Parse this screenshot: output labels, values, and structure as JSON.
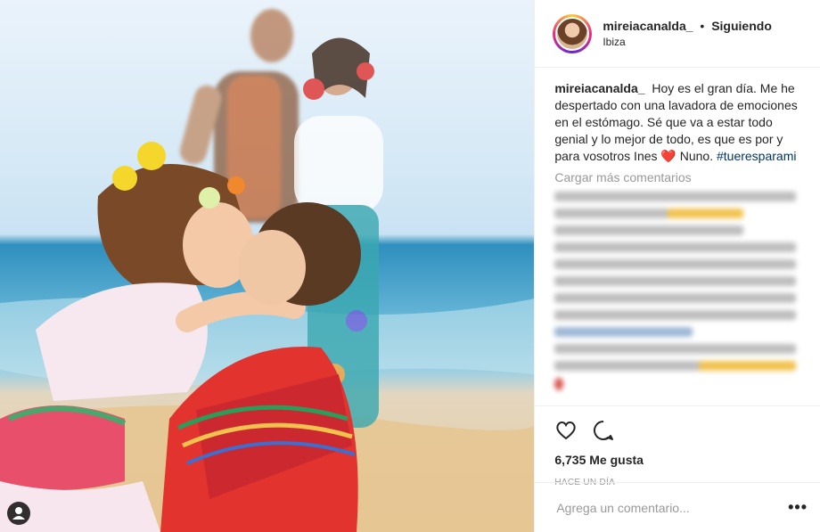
{
  "post": {
    "username": "mireiacanalda_",
    "separator": "•",
    "follow_state": "Siguiendo",
    "location": "Ibiza",
    "caption_text": "Hoy es el gran día. Me he despertado con una lavadora de emociones en el estómago. Sé que va a estar todo genial y lo mejor de todo, es que es por y para vosotros Ines",
    "caption_emoji": "❤️",
    "caption_after": "Nuno.",
    "hashtag": "#tueresparami",
    "load_more": "Cargar más comentarios",
    "likes": "6,735 Me gusta",
    "timestamp": "HACE UN DÍA",
    "comment_placeholder": "Agrega un comentario...",
    "more_options": "•••"
  },
  "icons": {
    "like": "heart-outline-icon",
    "comment": "speech-bubble-icon",
    "tagged_users": "person-tag-icon",
    "options": "ellipsis-icon"
  },
  "colors": {
    "text": "#262626",
    "muted": "#999999",
    "hashtag": "#003569",
    "border": "#efefef"
  }
}
